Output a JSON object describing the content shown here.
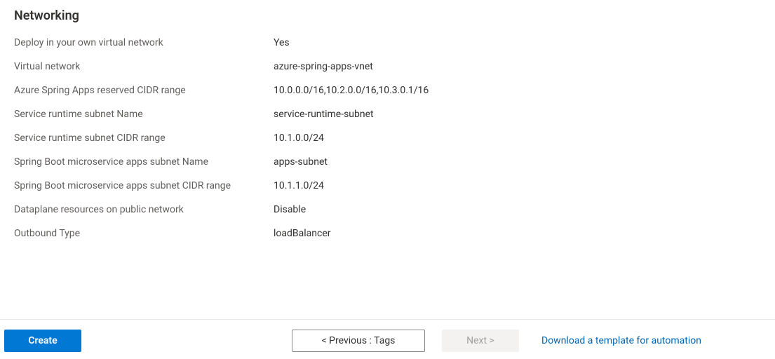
{
  "section": {
    "title": "Networking"
  },
  "fields": {
    "deploy_own_vnet": {
      "label": "Deploy in your own virtual network",
      "value": "Yes"
    },
    "virtual_network": {
      "label": "Virtual network",
      "value": "azure-spring-apps-vnet"
    },
    "reserved_cidr": {
      "label": "Azure Spring Apps reserved CIDR range",
      "value": "10.0.0.0/16,10.2.0.0/16,10.3.0.1/16"
    },
    "runtime_subnet_name": {
      "label": "Service runtime subnet Name",
      "value": "service-runtime-subnet"
    },
    "runtime_subnet_cidr": {
      "label": "Service runtime subnet CIDR range",
      "value": "10.1.0.0/24"
    },
    "apps_subnet_name": {
      "label": "Spring Boot microservice apps subnet Name",
      "value": "apps-subnet"
    },
    "apps_subnet_cidr": {
      "label": "Spring Boot microservice apps subnet CIDR range",
      "value": "10.1.1.0/24"
    },
    "dataplane_public": {
      "label": "Dataplane resources on public network",
      "value": "Disable"
    },
    "outbound_type": {
      "label": "Outbound Type",
      "value": "loadBalancer"
    }
  },
  "footer": {
    "create": "Create",
    "previous": "< Previous : Tags",
    "next": "Next >",
    "download_template": "Download a template for automation"
  }
}
